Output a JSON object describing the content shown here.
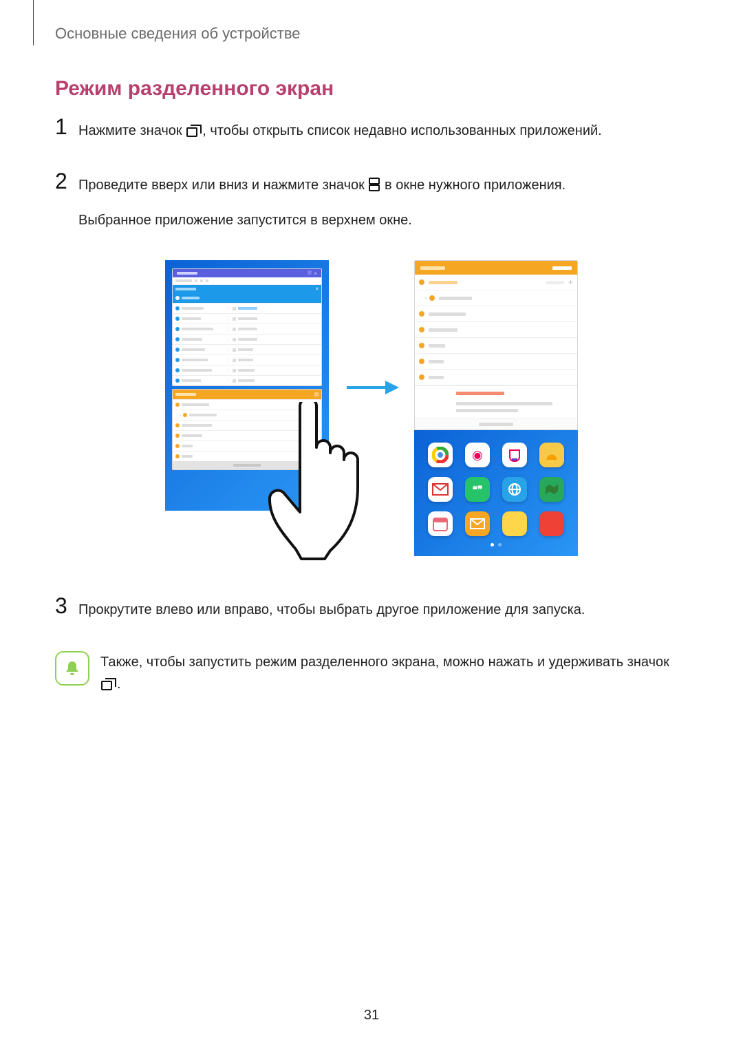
{
  "header": "Основные сведения об устройстве",
  "section_title": "Режим разделенного экран",
  "step1": {
    "num": "1",
    "prefix": "Нажмите значок ",
    "suffix": ", чтобы открыть список недавно использованных приложений."
  },
  "step2": {
    "num": "2",
    "line1_prefix": "Проведите вверх или вниз и нажмите значок ",
    "line1_suffix": " в окне нужного приложения.",
    "line2": "Выбранное приложение запустится в верхнем окне."
  },
  "step3": {
    "num": "3",
    "text": "Прокрутите влево или вправо, чтобы выбрать другое приложение для запуска."
  },
  "note": {
    "text_prefix": "Также, чтобы запустить режим разделенного экрана, можно нажать и удерживать значок ",
    "period": "."
  },
  "page_number": "31",
  "icons": {
    "recent": "recent-apps-icon",
    "split": "split-view-icon",
    "bell": "bell-icon"
  }
}
